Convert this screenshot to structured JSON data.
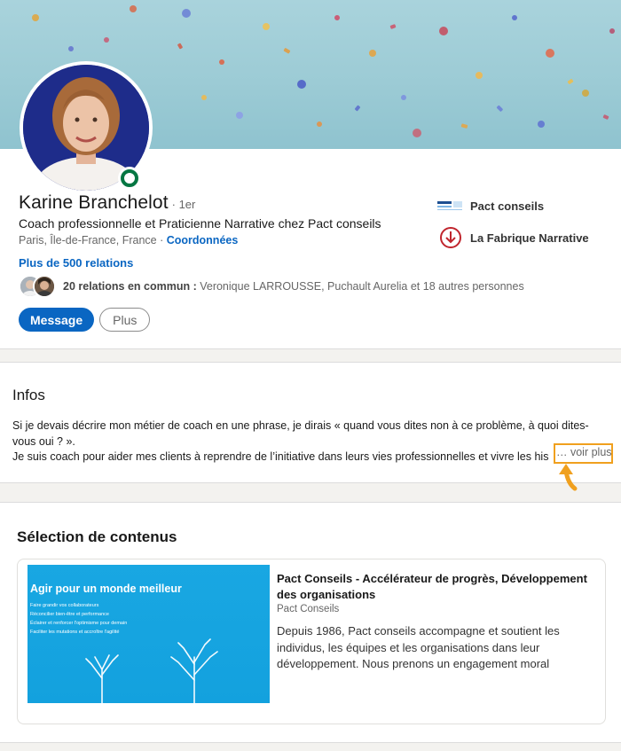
{
  "profile": {
    "name": "Karine Branchelot",
    "degree": "· 1er",
    "headline": "Coach professionnelle et Praticienne Narrative chez Pact conseils",
    "location": "Paris, Île-de-France, France ·",
    "contact_link": "Coordonnées",
    "relations": "Plus de 500 relations",
    "common_bold": "20 relations en commun :",
    "common_rest": "Veronique LARROUSSE, Puchault Aurelia et 18 autres personnes",
    "message_button": "Message",
    "more_button": "Plus",
    "companies": [
      {
        "name": "Pact conseils",
        "icon": "pact-conseils-logo"
      },
      {
        "name": "La Fabrique Narrative",
        "icon": "fabrique-narrative-logo"
      }
    ]
  },
  "infos": {
    "title": "Infos",
    "lines": [
      "Si je devais décrire mon métier de coach en une phrase, je dirais « quand vous dites non à ce problème, à quoi dites-",
      "vous oui ? ».",
      "Je suis coach pour aider mes clients à reprendre de l’initiative dans leurs vies professionnelles et vivre les his"
    ],
    "see_more": "… voir plus"
  },
  "selection": {
    "title": "Sélection de contenus",
    "media": {
      "thumb_title": "Agir pour un monde meilleur",
      "thumb_bullets": [
        "Faire grandir vos collaborateurs",
        "Réconcilier bien-être et performance",
        "Éclairer et renforcer l'optimisme pour demain",
        "Faciliter les mutations et accroître l'agilité"
      ],
      "title": "Pact Conseils - Accélérateur de progrès, Développement des organisations",
      "source": "Pact Conseils",
      "description": "Depuis 1986, Pact conseils accompagne et soutient les individus, les équipes et les organisations dans leur développement. Nous prenons un engagement moral"
    }
  },
  "colors": {
    "link_blue": "#0a66c2",
    "online_green": "#057642",
    "highlight_orange": "#f0a01e"
  }
}
